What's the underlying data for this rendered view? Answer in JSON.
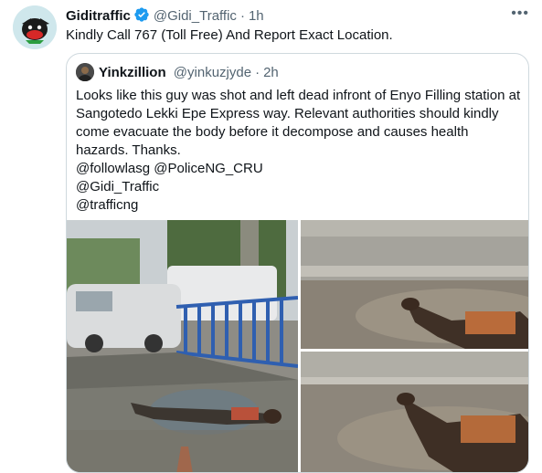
{
  "tweet": {
    "author_name": "Giditraffic",
    "handle": "@Gidi_Traffic",
    "separator": "·",
    "time": "1h",
    "more_label": "•••",
    "text": "Kindly Call 767 (Toll Free) And Report Exact Location."
  },
  "quote": {
    "author_name": "Yinkzillion",
    "handle": "@yinkuzjyde",
    "separator": "·",
    "time": "2h",
    "body": "Looks like this guy was shot and left dead infront of Enyo Filling station at Sangotedo Lekki Epe Express way. Relevant authorities should kindly come evacuate the body before it decompose and causes health hazards. Thanks.",
    "mentions": [
      "@followlasg  @PoliceNG_CRU",
      "@Gidi_Traffic",
      "@trafficng"
    ]
  },
  "colors": {
    "text_primary": "#0f1419",
    "text_secondary": "#536471",
    "verified": "#1d9bf0",
    "border": "#cfd9de"
  },
  "icons": {
    "verified": "verified-badge-icon",
    "more": "more-options-icon"
  }
}
